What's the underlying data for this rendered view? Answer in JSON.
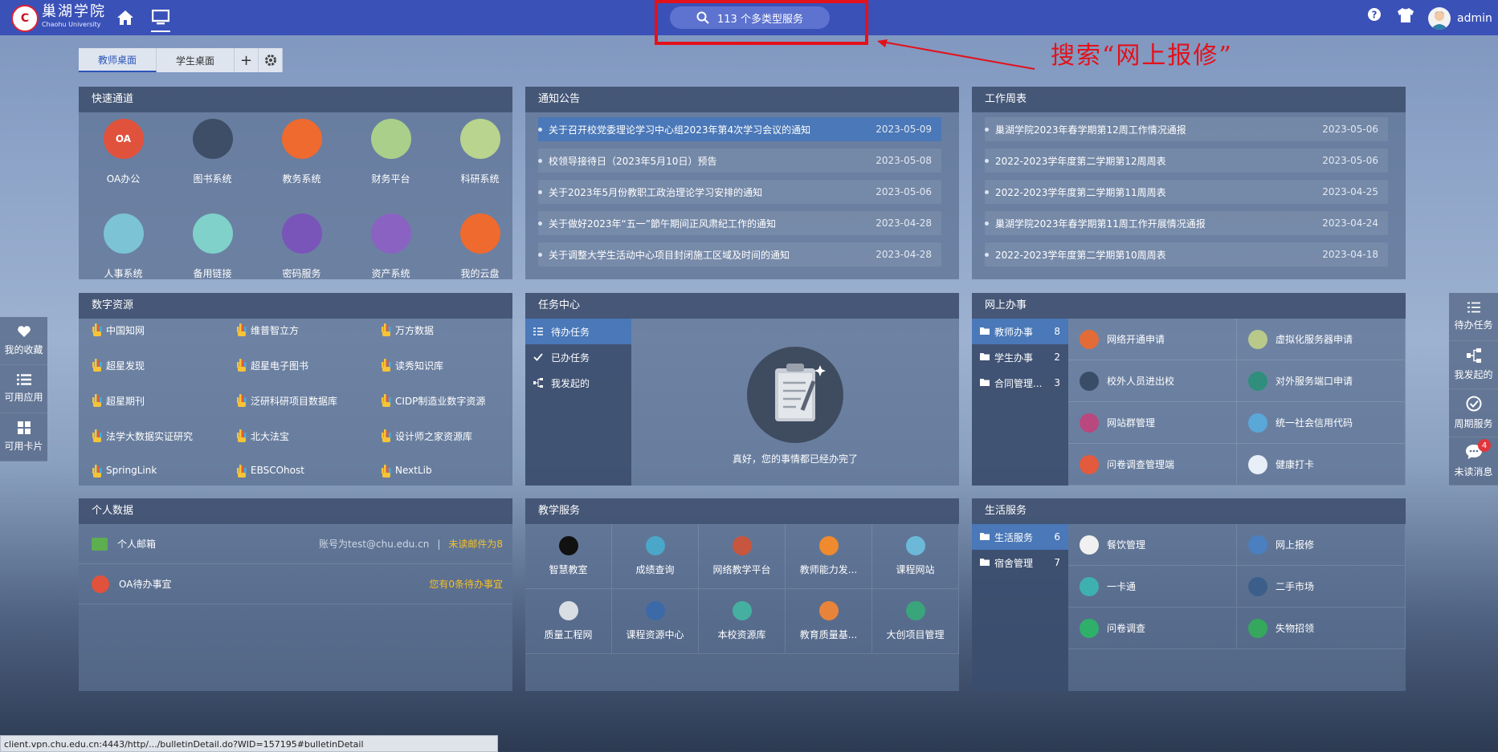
{
  "brand": {
    "logo_mark": "C",
    "name_cn": "巢湖学院",
    "name_en": "Chaohu University"
  },
  "topbar": {
    "search_placeholder": "113 个多类型服务",
    "username": "admin",
    "icons": [
      "home-icon",
      "desktop-icon",
      "search-icon",
      "help-icon",
      "skin-icon",
      "avatar"
    ]
  },
  "annotation": {
    "text": "搜索“网上报修”",
    "color": "#e3111a"
  },
  "desk_tabs": [
    {
      "label": "教师桌面"
    },
    {
      "label": "学生桌面"
    }
  ],
  "quick_access": {
    "title": "快速通道",
    "items": [
      {
        "label": "OA办公",
        "mark": "OA",
        "color": "#e0523c"
      },
      {
        "label": "图书系统",
        "mark": "",
        "color": "#3d4e66"
      },
      {
        "label": "教务系统",
        "mark": "",
        "color": "#ee6a2e"
      },
      {
        "label": "财务平台",
        "mark": "",
        "color": "#a9cf8b"
      },
      {
        "label": "科研系统",
        "mark": "",
        "color": "#b8d48e"
      },
      {
        "label": "人事系统",
        "mark": "",
        "color": "#7cc3d6"
      },
      {
        "label": "备用链接",
        "mark": "",
        "color": "#7fd1c9"
      },
      {
        "label": "密码服务",
        "mark": "",
        "color": "#7a55b9"
      },
      {
        "label": "资产系统",
        "mark": "",
        "color": "#8a62c2"
      },
      {
        "label": "我的云盘",
        "mark": "",
        "color": "#ee6a2e"
      }
    ]
  },
  "notices": {
    "title": "通知公告",
    "items": [
      {
        "text": "关于召开校党委理论学习中心组2023年第4次学习会议的通知",
        "date": "2023-05-09"
      },
      {
        "text": "校领导接待日（2023年5月10日）预告",
        "date": "2023-05-08"
      },
      {
        "text": "关于2023年5月份教职工政治理论学习安排的通知",
        "date": "2023-05-06"
      },
      {
        "text": "关于做好2023年“五一”節午期间正风肃纪工作的通知",
        "date": "2023-04-28"
      },
      {
        "text": "关于调整大学生活动中心项目封闭施工区域及时间的通知",
        "date": "2023-04-28"
      }
    ]
  },
  "weekly": {
    "title": "工作周表",
    "items": [
      {
        "text": "巢湖学院2023年春学期第12周工作情况通报",
        "date": "2023-05-06"
      },
      {
        "text": "2022-2023学年度第二学期第12周周表",
        "date": "2023-05-06"
      },
      {
        "text": "2022-2023学年度第二学期第11周周表",
        "date": "2023-04-25"
      },
      {
        "text": "巢湖学院2023年春学期第11周工作开展情况通报",
        "date": "2023-04-24"
      },
      {
        "text": "2022-2023学年度第二学期第10周周表",
        "date": "2023-04-18"
      }
    ]
  },
  "digital": {
    "title": "数字资源",
    "items": [
      "中国知网",
      "维普智立方",
      "万方数据",
      "超星发现",
      "超星电子图书",
      "读秀知识库",
      "超星期刊",
      "泛研科研项目数据库",
      "CIDP制造业数字资源",
      "法学大数据实证研究",
      "北大法宝",
      "设计师之家资源库",
      "SpringLink",
      "EBSCOhost",
      "NextLib"
    ]
  },
  "tasks": {
    "title": "任务中心",
    "items": [
      {
        "label": "待办任务"
      },
      {
        "label": "已办任务"
      },
      {
        "label": "我发起的"
      }
    ],
    "empty_text": "真好，您的事情都已经办完了"
  },
  "online": {
    "title": "网上办事",
    "categories": [
      {
        "label": "教师办事",
        "count": "8"
      },
      {
        "label": "学生办事",
        "count": "2"
      },
      {
        "label": "合同管理...",
        "count": "3"
      }
    ],
    "services": [
      {
        "label": "网络开通申请",
        "color": "#e36b37"
      },
      {
        "label": "虚拟化服务器申请",
        "color": "#b9c98a"
      },
      {
        "label": "校外人员进出校",
        "color": "#3a4d68"
      },
      {
        "label": "对外服务端口申请",
        "color": "#2f8f7c"
      },
      {
        "label": "网站群管理",
        "color": "#b8487e"
      },
      {
        "label": "统一社会信用代码",
        "color": "#5aa8d8"
      },
      {
        "label": "问卷调查管理端",
        "color": "#e35a3c"
      },
      {
        "label": "健康打卡",
        "color": "#e8eef8"
      }
    ]
  },
  "personal": {
    "title": "个人数据",
    "mail_label": "个人邮箱",
    "mail_account": "账号为test@chu.edu.cn",
    "mail_sep": "|",
    "mail_unread": "未读邮件为8",
    "oa_label": "OA待办事宜",
    "oa_status": "您有0条待办事宜",
    "accent": "#f2c02c"
  },
  "teaching": {
    "title": "教学服务",
    "items": [
      {
        "label": "智慧教室",
        "color": "#111111"
      },
      {
        "label": "成绩查询",
        "color": "#4aa7c9"
      },
      {
        "label": "网络教学平台",
        "color": "#c7563e"
      },
      {
        "label": "教师能力发...",
        "color": "#f08a2e"
      },
      {
        "label": "课程网站",
        "color": "#6cb8d8"
      },
      {
        "label": "质量工程网",
        "color": "#d9dde4"
      },
      {
        "label": "课程资源中心",
        "color": "#3c6aa8"
      },
      {
        "label": "本校资源库",
        "color": "#45b0a0"
      },
      {
        "label": "教育质量基...",
        "color": "#e8843a"
      },
      {
        "label": "大创项目管理",
        "color": "#3aa57a"
      }
    ]
  },
  "life": {
    "title": "生活服务",
    "categories": [
      {
        "label": "生活服务",
        "count": "6"
      },
      {
        "label": "宿舍管理",
        "count": "7"
      }
    ],
    "services": [
      {
        "label": "餐饮管理",
        "color": "#f0f0f0"
      },
      {
        "label": "网上报修",
        "color": "#4a7fc0"
      },
      {
        "label": "一卡通",
        "color": "#3fb0b0"
      },
      {
        "label": "二手市场",
        "color": "#3b5f8a"
      },
      {
        "label": "问卷调查",
        "color": "#2fb06a"
      },
      {
        "label": "失物招领",
        "color": "#35a85e"
      }
    ]
  },
  "left_rail": [
    {
      "label": "我的收藏"
    },
    {
      "label": "可用应用"
    },
    {
      "label": "可用卡片"
    }
  ],
  "right_rail": [
    {
      "label": "待办任务"
    },
    {
      "label": "我发起的"
    },
    {
      "label": "周期服务"
    },
    {
      "label": "未读消息",
      "badge": "4"
    }
  ],
  "status_url": "client.vpn.chu.edu.cn:4443/http/.../bulletinDetail.do?WID=157195#bulletinDetail"
}
